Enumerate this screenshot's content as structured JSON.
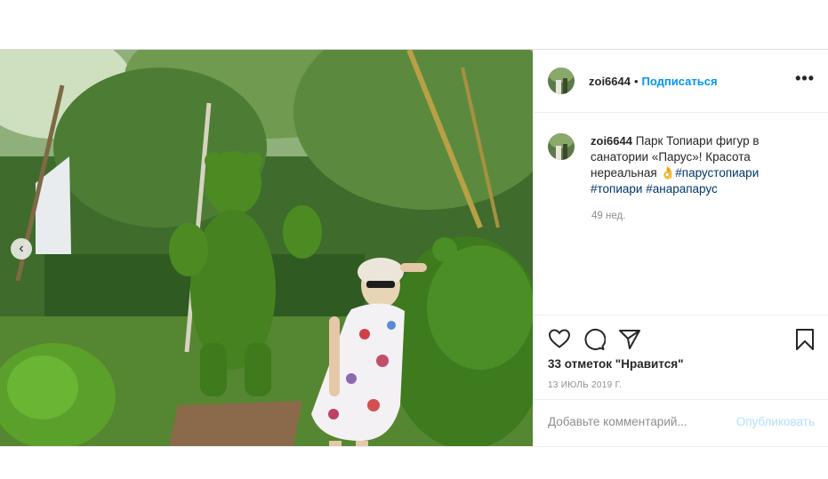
{
  "post": {
    "username": "zoi6644",
    "separator": "•",
    "follow_label": "Подписаться",
    "more_icon": "more-horizontal-icon",
    "more_label": "•••",
    "caption": {
      "text": "Парк Топиари фигур в санатории «Парус»! Красота нереальная",
      "emoji": "👌",
      "hashtags": [
        "#парустопиари",
        "#топиари",
        "#анарапарус"
      ]
    },
    "time_ago": "49 нед.",
    "likes_text": "33 отметок \"Нравится\"",
    "date": "13 ИЮЛЬ 2019 Г.",
    "comment_placeholder": "Добавьте комментарий...",
    "publish_label": "Опубликовать",
    "prev_label": "‹"
  },
  "colors": {
    "accent": "#0095f6",
    "hashtag": "#00376b",
    "publish_disabled": "#b2dffc",
    "muted": "#8e8e8e"
  }
}
